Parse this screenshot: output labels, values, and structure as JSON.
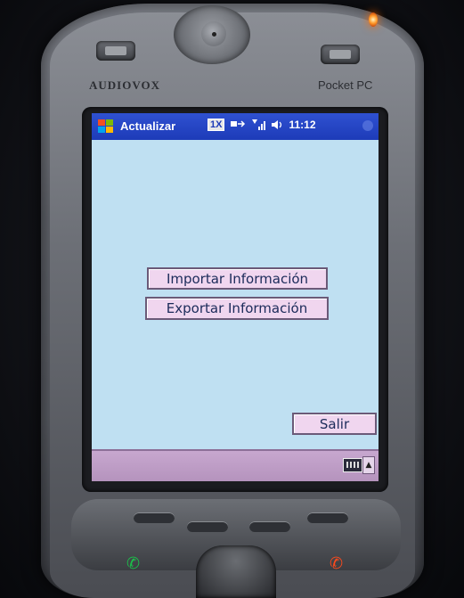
{
  "device": {
    "brand": "AUDIOVOX",
    "model": "Pocket PC"
  },
  "titlebar": {
    "title": "Actualizar",
    "network_badge": "1X",
    "time": "11:12"
  },
  "main": {
    "import_label": "Importar Información",
    "export_label": "Exportar Información",
    "exit_label": "Salir"
  },
  "icons": {
    "start": "windows-flag-icon",
    "connectivity": "connectivity-icon",
    "signal": "signal-strength-icon",
    "volume": "speaker-icon",
    "keyboard": "keyboard-icon",
    "sip_toggle": "arrow-up-icon",
    "call": "phone-call-icon",
    "hangup": "phone-end-icon"
  },
  "colors": {
    "titlebar": "#1d3bb8",
    "screen_background": "#bfe0f2",
    "button_face": "#f0d6ef",
    "bottombar": "#c7a7cf"
  }
}
